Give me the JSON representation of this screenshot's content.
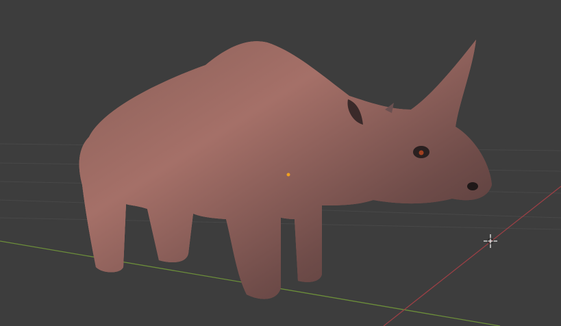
{
  "viewport": {
    "background_color": "#3d3d3d",
    "grid_color": "#4a4a4a",
    "x_axis_color": "#9a3f45",
    "y_axis_color": "#6c8e3a",
    "mesh_wire_color": "#1e1a1a",
    "model_colors": [
      "#6e4a48",
      "#8a5d55",
      "#a0706a",
      "#4e3838"
    ],
    "origin_color": "#f0a020",
    "icons": {
      "cursor": "3d-cursor-icon",
      "origin": "object-origin-icon"
    }
  }
}
